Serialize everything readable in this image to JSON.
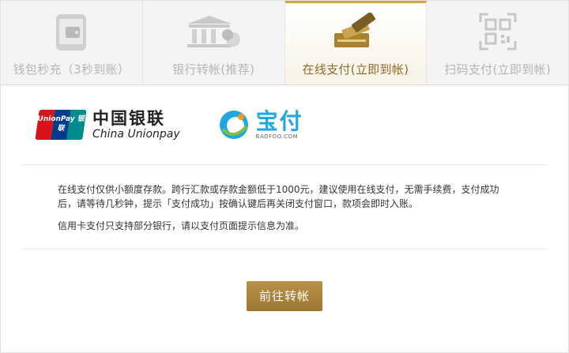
{
  "tabs": [
    {
      "label": "钱包秒充（3秒到账）",
      "icon": "wallet-phone-icon",
      "active": false
    },
    {
      "label": "银行转帐(推荐)",
      "icon": "bank-icon",
      "active": false
    },
    {
      "label": "在线支付(立即到帐)",
      "icon": "card-payment-icon",
      "active": true
    },
    {
      "label": "扫码支付(立即到帐)",
      "icon": "qr-code-icon",
      "active": false
    }
  ],
  "logos": {
    "unionpay_card_text": "UnionPay 银联",
    "unionpay_cn": "中国银联",
    "unionpay_en": "China Unionpay",
    "baofoo_cn": "宝付",
    "baofoo_en": "BAOFOO.COM"
  },
  "notice": {
    "line1": "在线支付仅供小额度存款。跨行汇款或存款金额低于1000元，建议使用在线支付，无需手续费，支付成功后，请等待几秒钟，提示「支付成功」按确认键后再关闭支付窗口，款项会即时入账。",
    "line2": "信用卡支付只支持部分银行，请以支付页面提示信息为准。"
  },
  "button": {
    "label": "前往转帐"
  },
  "colors": {
    "accent": "#cfa64a",
    "button": "#a88439",
    "inactive_text": "#b5b5b5"
  }
}
